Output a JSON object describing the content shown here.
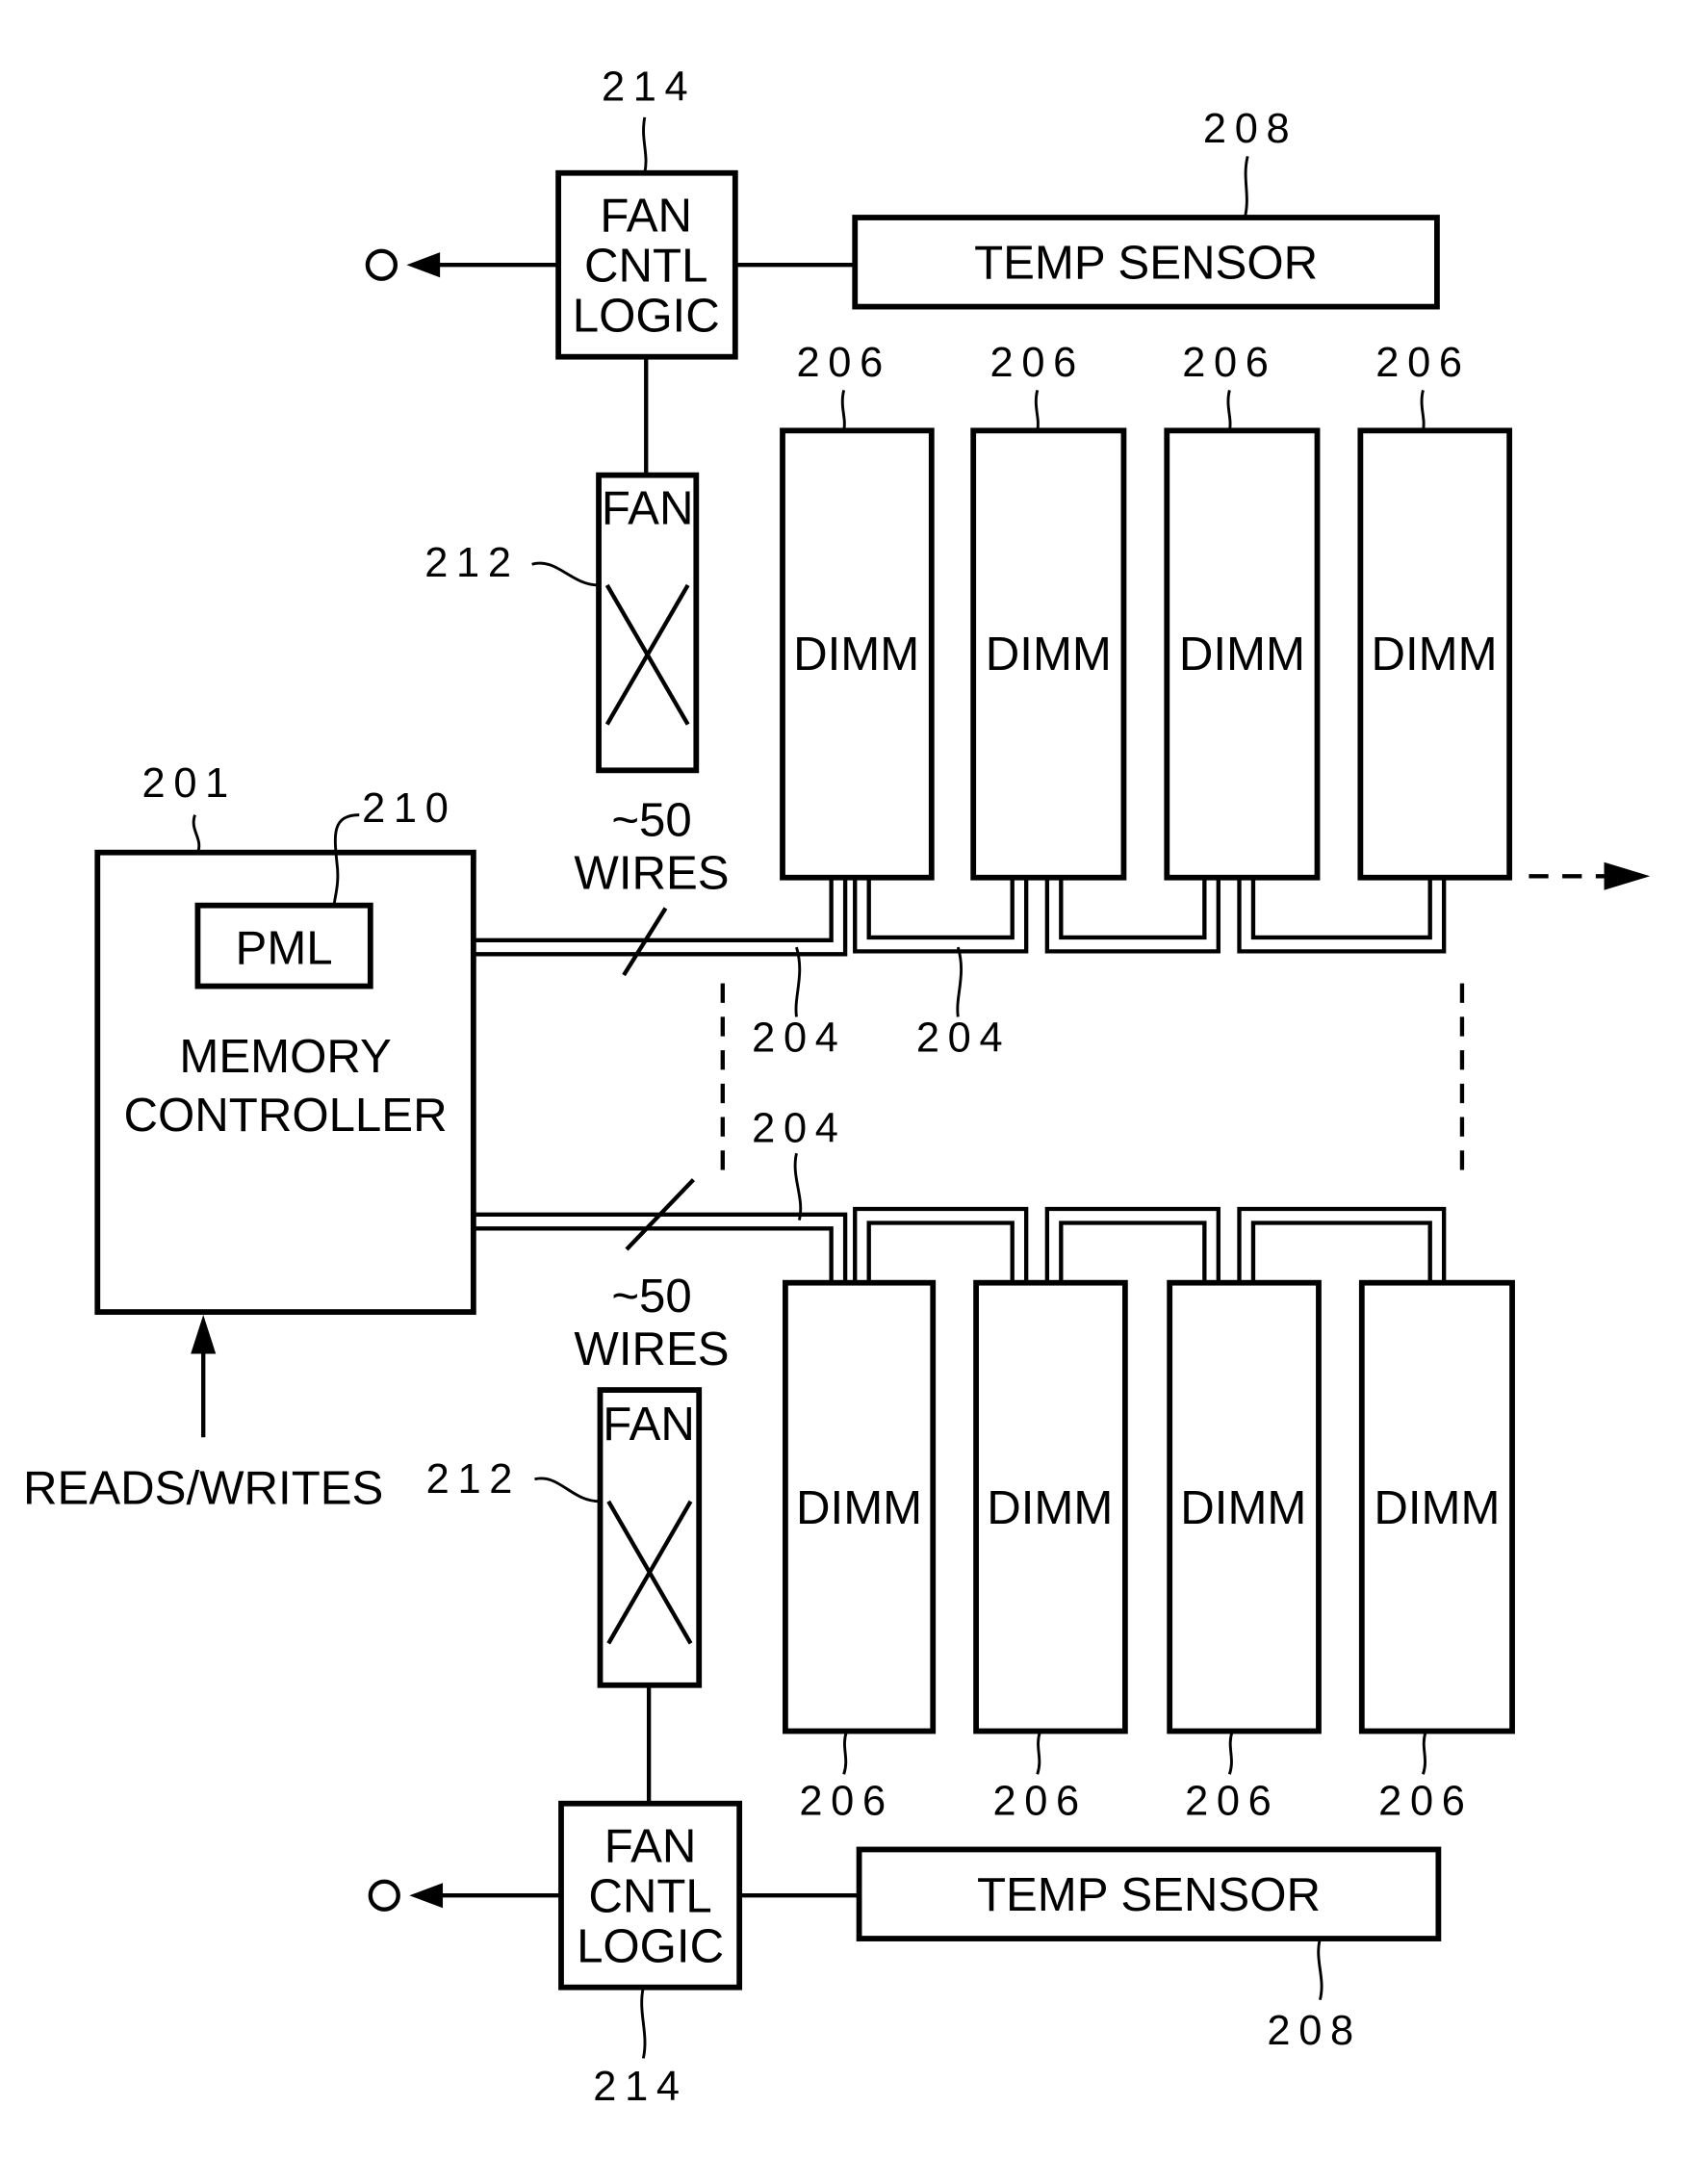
{
  "figure": {
    "memory_controller": {
      "ref": "201",
      "label_line1": "MEMORY",
      "label_line2": "CONTROLLER"
    },
    "pml": {
      "ref": "210",
      "label": "PML"
    },
    "reads_writes": {
      "label": "READS/WRITES"
    },
    "bus_top": {
      "wires_line1": "~50",
      "wires_line2": "WIRES",
      "ref_a": "204",
      "ref_b": "204"
    },
    "bus_bottom": {
      "wires_line1": "~50",
      "wires_line2": "WIRES",
      "ref": "204"
    },
    "dimms_top": [
      {
        "label": "DIMM",
        "ref": "206"
      },
      {
        "label": "DIMM",
        "ref": "206"
      },
      {
        "label": "DIMM",
        "ref": "206"
      },
      {
        "label": "DIMM",
        "ref": "206"
      }
    ],
    "dimms_bottom": [
      {
        "label": "DIMM",
        "ref": "206"
      },
      {
        "label": "DIMM",
        "ref": "206"
      },
      {
        "label": "DIMM",
        "ref": "206"
      },
      {
        "label": "DIMM",
        "ref": "206"
      }
    ],
    "fan_top": {
      "label": "FAN",
      "ref": "212"
    },
    "fan_bottom": {
      "label": "FAN",
      "ref": "212"
    },
    "fan_cntl_top": {
      "line1": "FAN",
      "line2": "CNTL",
      "line3": "LOGIC",
      "ref": "214"
    },
    "fan_cntl_bottom": {
      "line1": "FAN",
      "line2": "CNTL",
      "line3": "LOGIC",
      "ref": "214"
    },
    "temp_top": {
      "label": "TEMP SENSOR",
      "ref": "208"
    },
    "temp_bottom": {
      "label": "TEMP SENSOR",
      "ref": "208"
    }
  }
}
